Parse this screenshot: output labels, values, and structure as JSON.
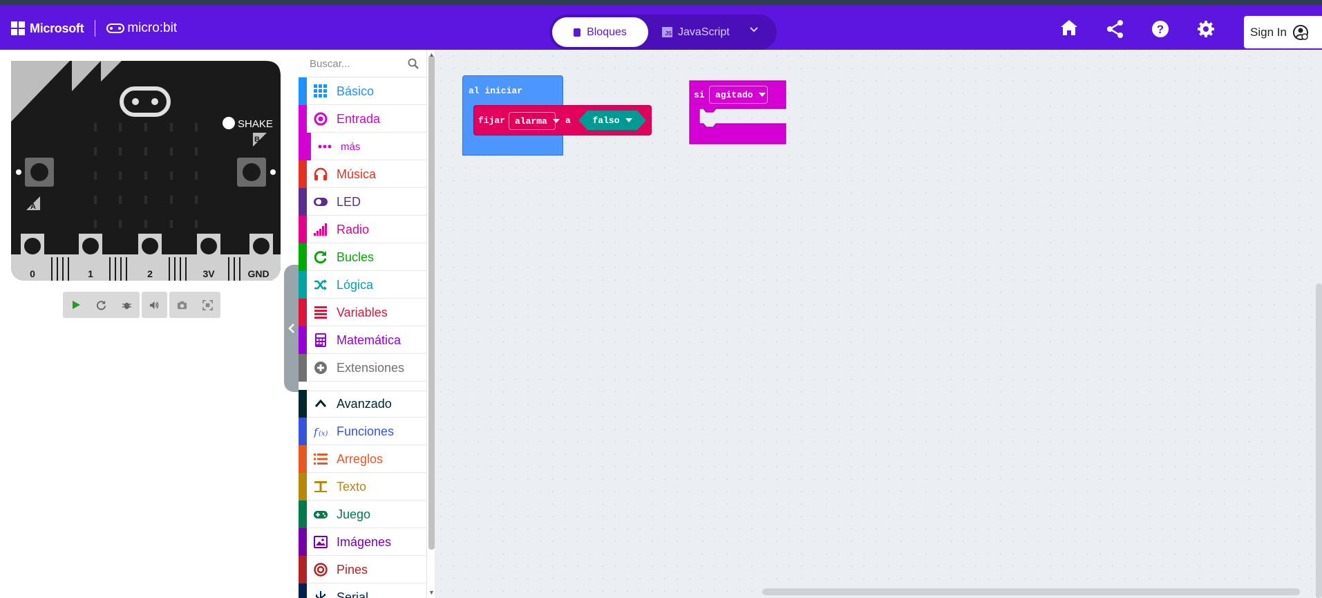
{
  "header": {
    "brand_microsoft": "Microsoft",
    "brand_microbit": "micro:bit",
    "tab_blocks": "Bloques",
    "tab_javascript": "JavaScript",
    "js_badge": "JS",
    "sign_in": "Sign In",
    "icons": [
      "home-icon",
      "share-icon",
      "help-icon",
      "settings-icon",
      "user-icon"
    ]
  },
  "simulator": {
    "shake_label": "SHAKE",
    "button_a": "A",
    "button_b": "B",
    "pins": [
      "0",
      "1",
      "2",
      "3V",
      "GND"
    ]
  },
  "toolbox": {
    "search_placeholder": "Buscar...",
    "categories": [
      {
        "label": "Básico",
        "color": "#1e90ff"
      },
      {
        "label": "Entrada",
        "color": "#d400d4"
      },
      {
        "label": "más",
        "color": "#d400d4"
      },
      {
        "label": "Música",
        "color": "#e63022"
      },
      {
        "label": "LED",
        "color": "#5c2d91"
      },
      {
        "label": "Radio",
        "color": "#e3008c"
      },
      {
        "label": "Bucles",
        "color": "#00aa00"
      },
      {
        "label": "Lógica",
        "color": "#00a4a6"
      },
      {
        "label": "Variables",
        "color": "#dc143c"
      },
      {
        "label": "Matemática",
        "color": "#9400d3"
      },
      {
        "label": "Extensiones",
        "color": "#717171"
      },
      {
        "label": "Avanzado",
        "color": "#00272b"
      },
      {
        "label": "Funciones",
        "color": "#3455db"
      },
      {
        "label": "Arreglos",
        "color": "#e65722"
      },
      {
        "label": "Texto",
        "color": "#b8860b"
      },
      {
        "label": "Juego",
        "color": "#007a4b"
      },
      {
        "label": "Imágenes",
        "color": "#7600a8"
      },
      {
        "label": "Pines",
        "color": "#b22222"
      },
      {
        "label": "Serial",
        "color": "#002050"
      }
    ]
  },
  "workspace": {
    "on_start": "al iniciar",
    "set_word": "fijar",
    "variable": "alarma",
    "to_word": "a",
    "bool_value": "falso",
    "if_word": "si",
    "gesture": "agitado"
  }
}
